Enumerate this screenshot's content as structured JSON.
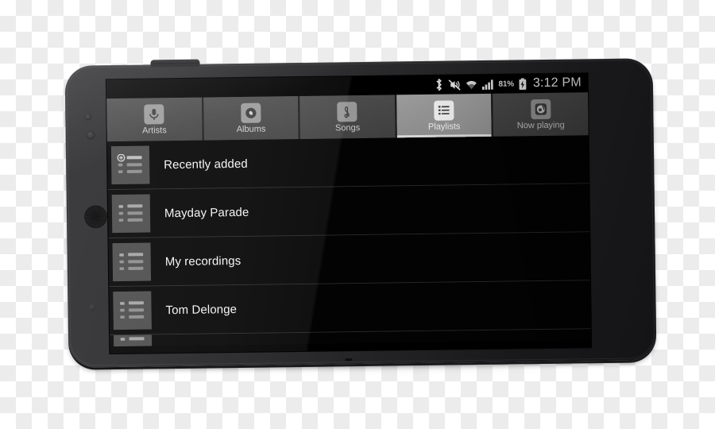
{
  "device": {
    "name": "android-smartphone",
    "orientation": "landscape"
  },
  "statusbar": {
    "icons": [
      "bluetooth-icon",
      "vibrate-mute-icon",
      "wifi-icon",
      "cellular-signal-icon"
    ],
    "battery_percent": "81%",
    "battery_icon": "battery-charging-icon",
    "clock": "3:12 PM"
  },
  "tabs": [
    {
      "label": "Artists",
      "icon": "microphone-icon",
      "selected": false
    },
    {
      "label": "Albums",
      "icon": "disc-icon",
      "selected": false
    },
    {
      "label": "Songs",
      "icon": "treble-clef-icon",
      "selected": false
    },
    {
      "label": "Playlists",
      "icon": "list-icon",
      "selected": true
    },
    {
      "label": "Now playing",
      "icon": "turntable-icon",
      "selected": false
    }
  ],
  "playlists": [
    {
      "label": "Recently added",
      "icon": "playlist-add-icon"
    },
    {
      "label": "Mayday Parade",
      "icon": "playlist-icon"
    },
    {
      "label": "My recordings",
      "icon": "playlist-icon"
    },
    {
      "label": "Tom Delonge",
      "icon": "playlist-icon"
    }
  ],
  "colors": {
    "screen_background": "#000000",
    "tab_unselected": "#4a4a4a",
    "tab_selected": "#9c9c9c",
    "accent_text": "#ffffff",
    "thumb_background": "#4a4a4a",
    "device_body": "#2e2e30"
  }
}
